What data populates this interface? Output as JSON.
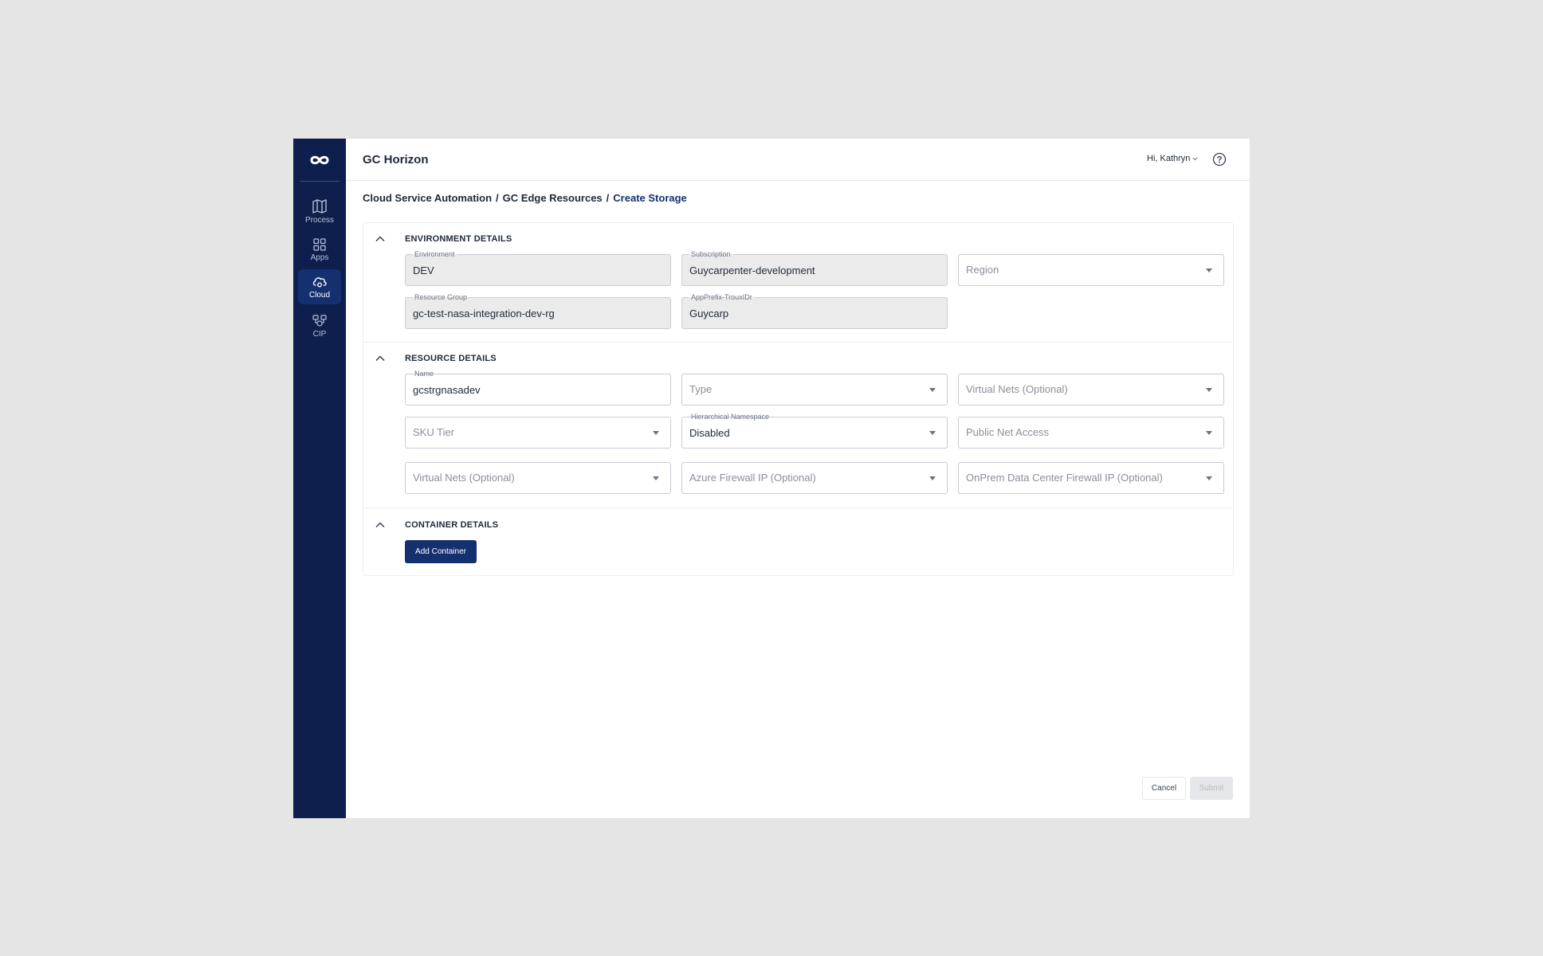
{
  "app": {
    "title": "GC Horizon"
  },
  "user": {
    "greeting": "Hi, Kathryn"
  },
  "sidebar": {
    "items": [
      {
        "label": "Process",
        "icon": "map-icon"
      },
      {
        "label": "Apps",
        "icon": "grid-icon"
      },
      {
        "label": "Cloud",
        "icon": "cloud-icon",
        "active": true
      },
      {
        "label": "CIP",
        "icon": "cip-icon"
      }
    ]
  },
  "breadcrumb": {
    "items": [
      "Cloud Service Automation",
      "GC Edge Resources"
    ],
    "current": "Create Storage",
    "separator": "/"
  },
  "environment": {
    "title": "ENVIRONMENT DETAILS",
    "environment": {
      "label": "Environment",
      "value": "DEV"
    },
    "subscription": {
      "label": "Subscription",
      "value": "Guycarpenter-development"
    },
    "region": {
      "placeholder": "Region"
    },
    "resource_group": {
      "label": "Resource Group",
      "value": "gc-test-nasa-integration-dev-rg"
    },
    "app_prefix": {
      "label": "AppPrefix-TrouxIDr",
      "value": "Guycarp"
    }
  },
  "resource": {
    "title": "RESOURCE DETAILS",
    "name": {
      "label": "Name",
      "value": "gcstrgnasadev"
    },
    "type": {
      "placeholder": "Type"
    },
    "virtual_nets_1": {
      "placeholder": "Virtual Nets (Optional)"
    },
    "sku_tier": {
      "placeholder": "SKU Tier"
    },
    "hierarchical_namespace": {
      "label": "Hierarchical Namespace",
      "value": "Disabled"
    },
    "public_net_access": {
      "placeholder": "Public Net Access"
    },
    "virtual_nets_2": {
      "placeholder": "Virtual Nets (Optional)"
    },
    "azure_firewall_ip": {
      "placeholder": "Azure Firewall IP (Optional)"
    },
    "onprem_firewall_ip": {
      "placeholder": "OnPrem Data Center Firewall IP (Optional)"
    }
  },
  "container": {
    "title": "CONTAINER DETAILS",
    "add_label": "Add Container"
  },
  "actions": {
    "cancel": "Cancel",
    "submit": "Submit"
  },
  "colors": {
    "sidebar": "#0e1f4d",
    "sidebar_active": "#14306e",
    "accent": "#14306e",
    "readonly_field": "#ebebeb",
    "background": "#e5e5e5"
  }
}
